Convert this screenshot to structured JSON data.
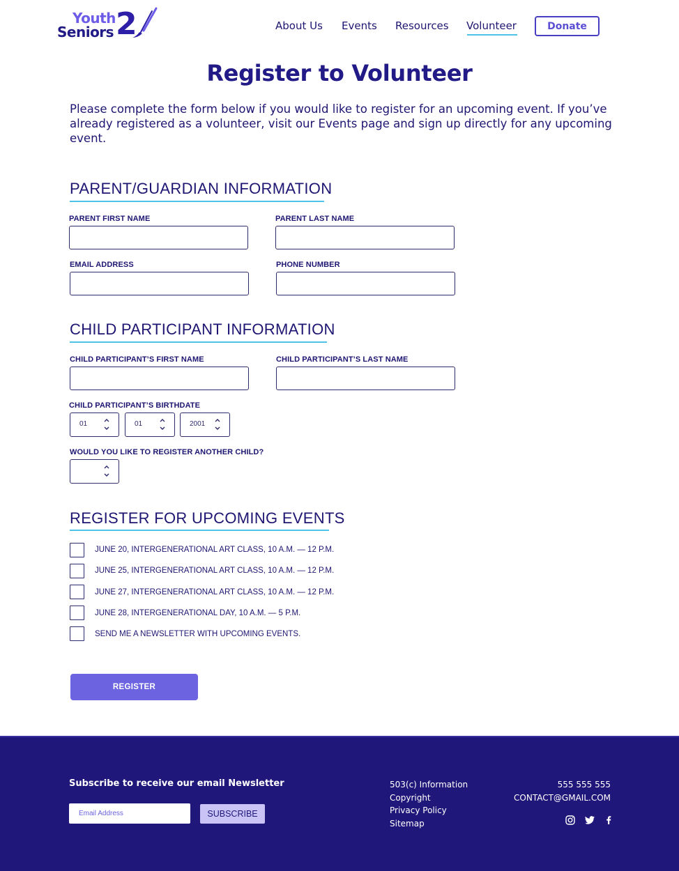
{
  "brand": {
    "line1": "Youth",
    "line2": "Seniors",
    "numeral": "2"
  },
  "nav": {
    "items": [
      "About Us",
      "Events",
      "Resources",
      "Volunteer"
    ],
    "active": "Volunteer",
    "donate_label": "Donate"
  },
  "page": {
    "title": "Register to Volunteer",
    "intro": "Please complete the form below if you would like to register for an upcoming event. If you’ve already registered as a volunteer, visit our Events page and sign up directly for any upcoming event."
  },
  "parent_section": {
    "title": "PARENT/GUARDIAN INFORMATION",
    "first_name_label": "PARENT FIRST NAME",
    "last_name_label": "PARENT LAST NAME",
    "email_label": "EMAIL ADDRESS",
    "phone_label": "PHONE NUMBER"
  },
  "child_section": {
    "title": "CHILD PARTICIPANT INFORMATION",
    "first_name_label": "CHILD PARTICIPANT’S FIRST NAME",
    "last_name_label": "CHILD PARTICIPANT’S LAST NAME",
    "birthdate_label": "CHILD PARTICIPANT’S BIRTHDATE",
    "birth_month": "01",
    "birth_day": "01",
    "birth_year": "2001",
    "another_child_label": "WOULD YOU LIKE TO REGISTER ANOTHER CHILD?",
    "another_child_value": ""
  },
  "events_section": {
    "title": "REGISTER FOR UPCOMING EVENTS",
    "options": [
      "JUNE 20, INTERGENERATIONAL ART CLASS, 10 A.M. — 12 P.M.",
      "JUNE 25, INTERGENERATIONAL ART CLASS, 10 A.M. — 12 P.M.",
      "JUNE 27, INTERGENERATIONAL ART CLASS, 10 A.M. — 12 P.M.",
      "JUNE 28, INTERGENERATIONAL DAY, 10 A.M. — 5 P.M.",
      "SEND ME A NEWSLETTER WITH UPCOMING EVENTS."
    ],
    "register_label": "REGISTER"
  },
  "footer": {
    "subscribe_title": "Subscribe to receive our email Newsletter",
    "email_placeholder": "Email Address",
    "subscribe_label": "SUBSCRIBE",
    "links": [
      "503(c) Information",
      "Copyright",
      "Privacy Policy",
      "Sitemap"
    ],
    "phone": "555 555 555",
    "email": "CONTACT@GMAIL.COM",
    "social": [
      "instagram-icon",
      "twitter-icon",
      "facebook-icon"
    ]
  },
  "colors": {
    "primary": "#221a86",
    "accent": "#6c63e0",
    "underline": "#4ec3e8",
    "footer_bg": "#20177a"
  }
}
